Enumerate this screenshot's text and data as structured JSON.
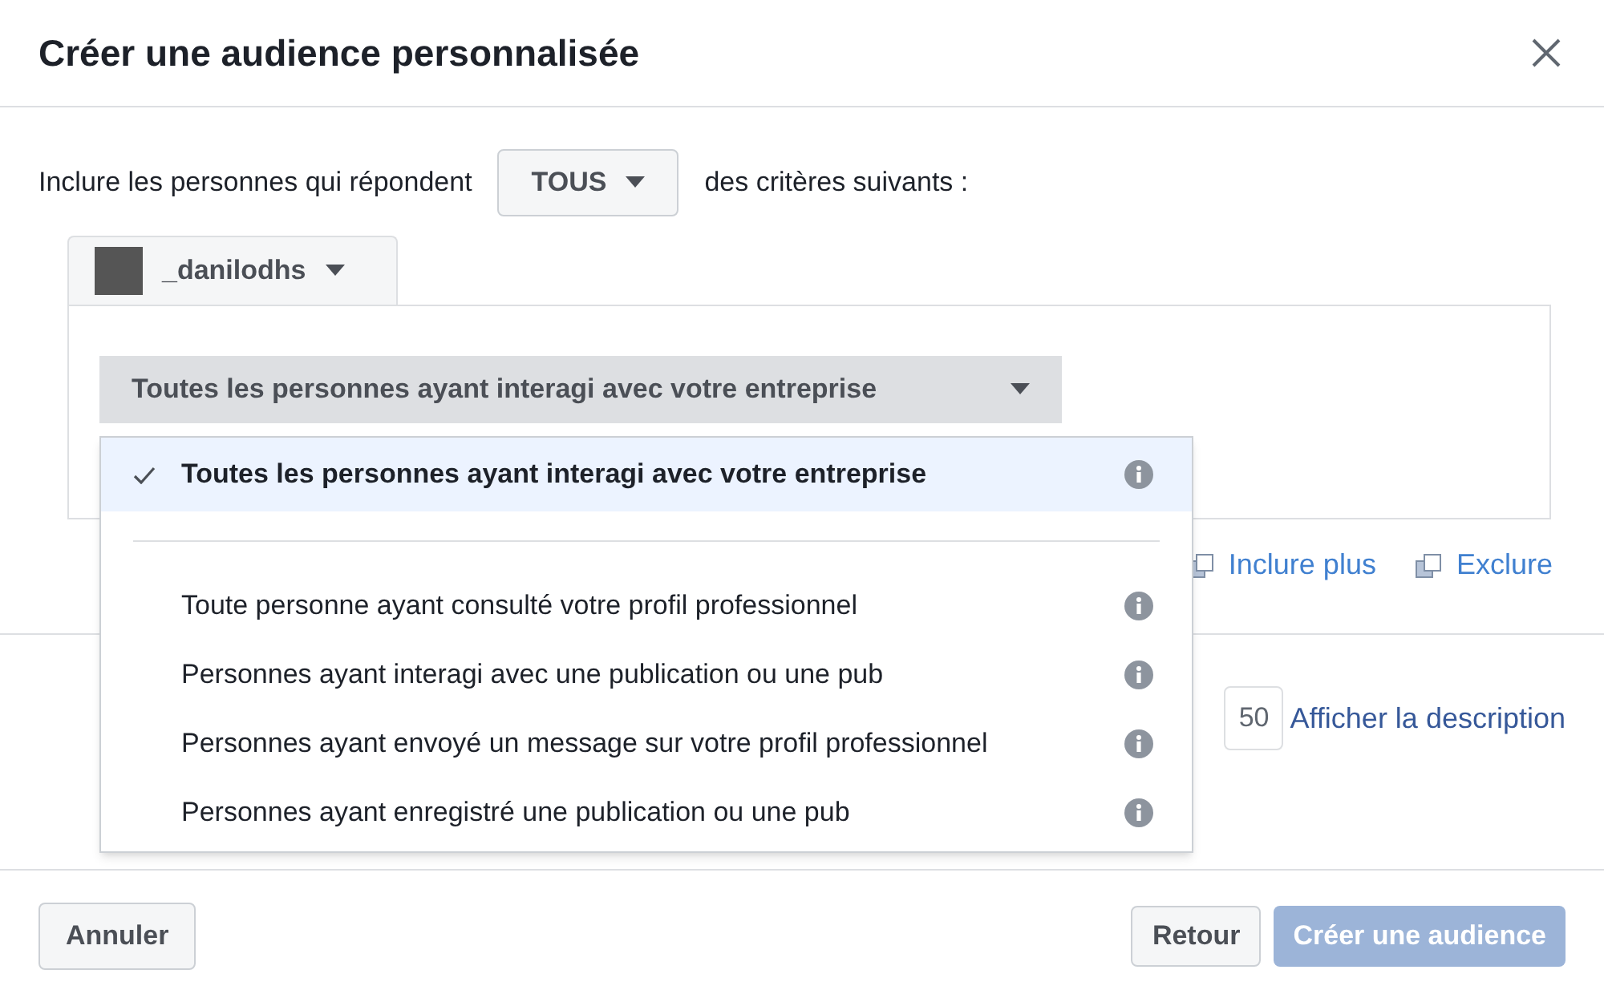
{
  "dialog": {
    "title": "Créer une audience personnalisée"
  },
  "criteria": {
    "prefix": "Inclure les personnes qui répondent",
    "match": "TOUS",
    "suffix": "des critères suivants :"
  },
  "account": {
    "name": "_danilodhs"
  },
  "source": {
    "value": "Toutes les personnes ayant interagi avec votre entreprise"
  },
  "menu": {
    "items": [
      {
        "label": "Toutes les personnes ayant interagi avec votre entreprise",
        "selected": true
      },
      {
        "label": "Toute personne ayant consulté votre profil professionnel",
        "selected": false
      },
      {
        "label": "Personnes ayant interagi avec une publication ou une pub",
        "selected": false
      },
      {
        "label": "Personnes ayant envoyé un message sur votre profil professionnel",
        "selected": false
      },
      {
        "label": "Personnes ayant enregistré une publication ou une pub",
        "selected": false
      }
    ]
  },
  "actions": [
    {
      "label": "Inclure plus"
    },
    {
      "label": "Exclure"
    }
  ],
  "name_row": {
    "counter": "50",
    "link": "Afficher la description"
  },
  "footer": {
    "cancel": "Annuler",
    "back": "Retour",
    "create": "Créer une audience",
    "create_disabled": true
  }
}
